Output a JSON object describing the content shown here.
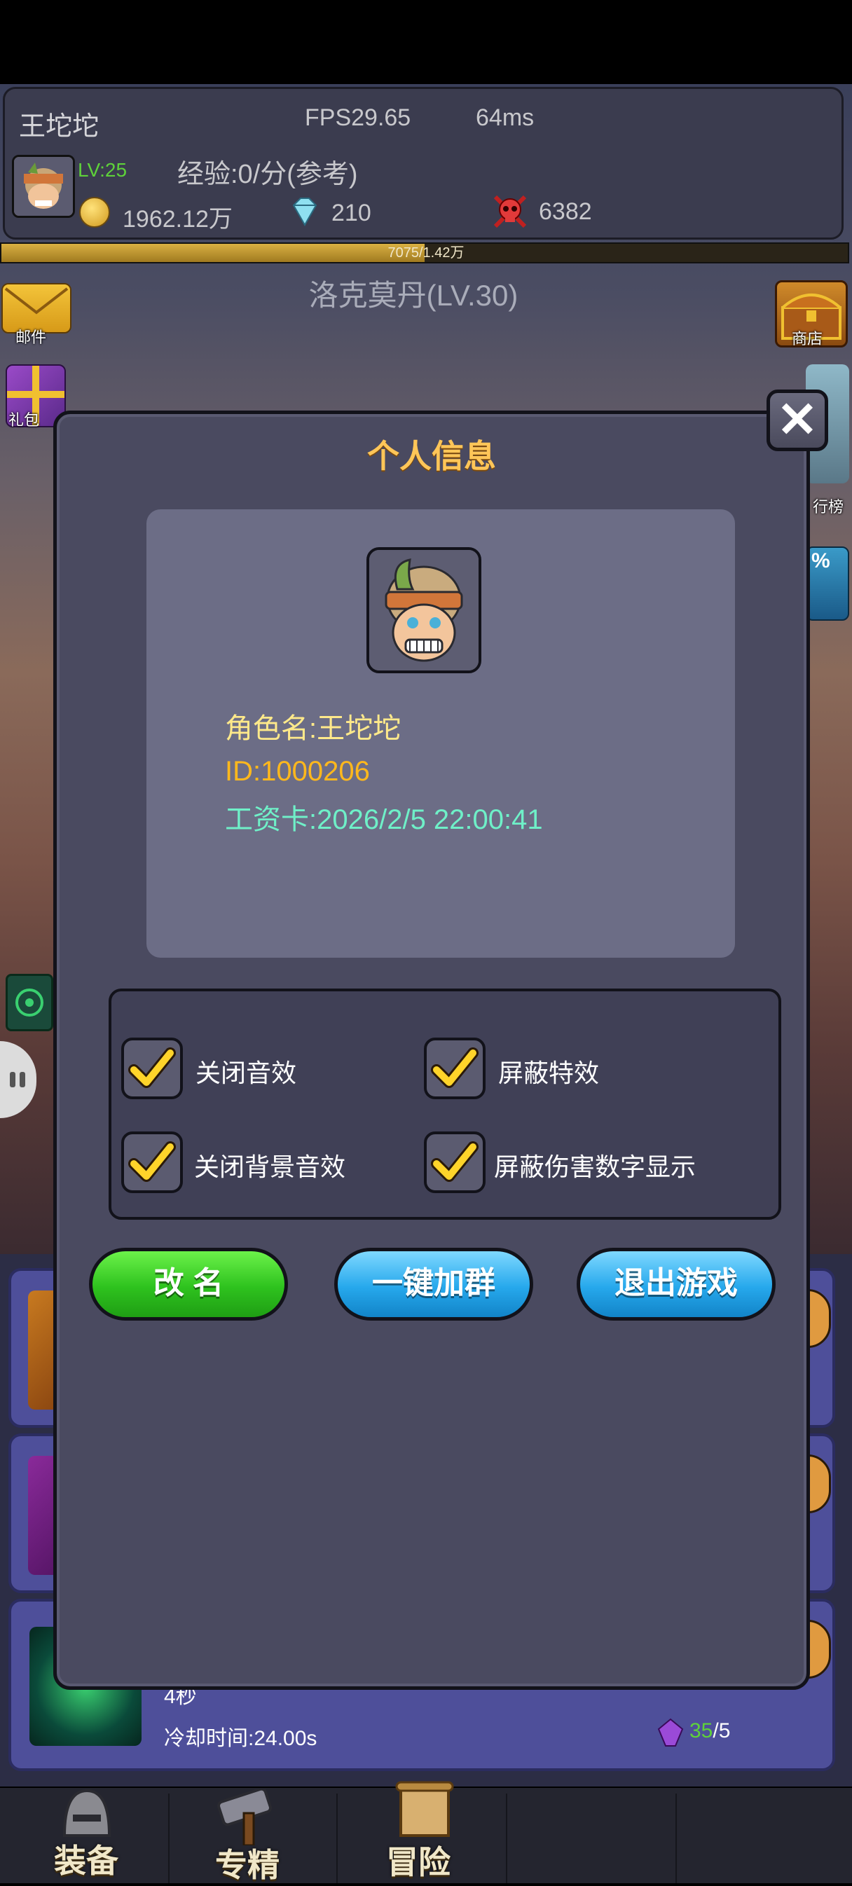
{
  "hud": {
    "player_name": "王坨坨",
    "fps": "FPS29.65",
    "ping": "64ms",
    "level": "LV:25",
    "exp": "经验:0/分(参考)",
    "gold": "1962.12万",
    "diamonds": "210",
    "kills": "6382",
    "xp_text": "7075/1.42万",
    "xp_fraction": 0.5
  },
  "stage_name": "洛克莫丹(LV.30)",
  "side_icons": {
    "mail": "邮件",
    "gift": "礼包",
    "shop": "商店",
    "rank_partial": "行榜",
    "percent_partial": "%"
  },
  "behind": {
    "seconds": "4秒",
    "cooldown": "冷却时间:24.00s",
    "gem_count": "35",
    "gem_max": "/5"
  },
  "modal": {
    "title": "个人信息",
    "close": "✕",
    "role_name": "角色名:王坨坨",
    "id": "ID:1000206",
    "wage_card": "工资卡:2026/2/5 22:00:41",
    "settings": [
      {
        "label": "关闭音效",
        "checked": true
      },
      {
        "label": "屏蔽特效",
        "checked": true
      },
      {
        "label": "关闭背景音效",
        "checked": true
      },
      {
        "label": "屏蔽伤害数字显示",
        "checked": true
      }
    ],
    "buttons": {
      "rename": "改 名",
      "join_group": "一键加群",
      "quit": "退出游戏"
    }
  },
  "nav": {
    "equip": "装备",
    "specialize": "专精",
    "adventure": "冒险"
  },
  "colors": {
    "title": "#ffc658",
    "role_name": "#ffe98a",
    "id": "#ffb81c",
    "wage": "#6ff0c8",
    "level": "#5ed13a",
    "green_button": "#2ec21e",
    "blue_button": "#26a8ec"
  }
}
